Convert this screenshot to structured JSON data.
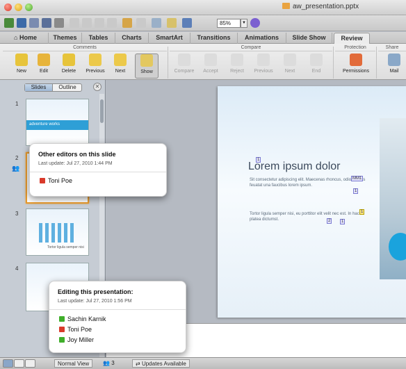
{
  "window": {
    "title": "aw_presentation.pptx"
  },
  "toolbar": {
    "zoom_value": "85%"
  },
  "tabs": [
    "Home",
    "Themes",
    "Tables",
    "Charts",
    "SmartArt",
    "Transitions",
    "Animations",
    "Slide Show",
    "Review"
  ],
  "active_tab": "Review",
  "ribbon": {
    "groups": {
      "comments": "Comments",
      "compare": "Compare",
      "protection": "Protection",
      "share": "Share"
    },
    "comments_buttons": [
      "New",
      "Edit",
      "Delete",
      "Previous",
      "Next",
      "Show"
    ],
    "compare_buttons": [
      "Compare",
      "Accept",
      "Reject",
      "Previous",
      "Next",
      "End"
    ],
    "protection_buttons": [
      "Permissions"
    ],
    "share_buttons": [
      "Mail"
    ]
  },
  "pane": {
    "tab_slides": "Slides",
    "tab_outline": "Outline",
    "close_glyph": "✕"
  },
  "slides": {
    "numbers": [
      "1",
      "2",
      "3",
      "4"
    ],
    "thumb1_title": "adventure works",
    "thumb3_caption": "Tortor ligula semper nisi"
  },
  "slide": {
    "title": "Lorem ipsum dolor",
    "body1": "Sit consectetur adipiscing elit. Maecenas rhoncus, odio saeittis feuatat una faucibus lorem ipsum.",
    "body2": "Tortor ligula semper nisi, eu porttitor elit velit nec est. In hac platea dictumst.",
    "markers": {
      "m1": "1",
      "m2": "MM1",
      "m3": "1",
      "m4": "1",
      "m5": "2",
      "m6": "1"
    }
  },
  "popup_slide": {
    "title": "Other editors on this slide",
    "last_update": "Last update:   Jul 27, 2010 1:44 PM",
    "users": [
      {
        "name": "Toni Poe",
        "color": "#d93a2b"
      }
    ]
  },
  "popup_presentation": {
    "title": "Editing this presentation:",
    "last_update": "Last update:   Jul 27, 2010 1:56 PM",
    "users": [
      {
        "name": "Sachin Karnik",
        "color": "#3fae2a"
      },
      {
        "name": "Toni Poe",
        "color": "#d93a2b"
      },
      {
        "name": "Joy Miller",
        "color": "#3fae2a"
      }
    ]
  },
  "status": {
    "view": "Normal View",
    "editors_count": "3",
    "updates": "Updates Available"
  }
}
